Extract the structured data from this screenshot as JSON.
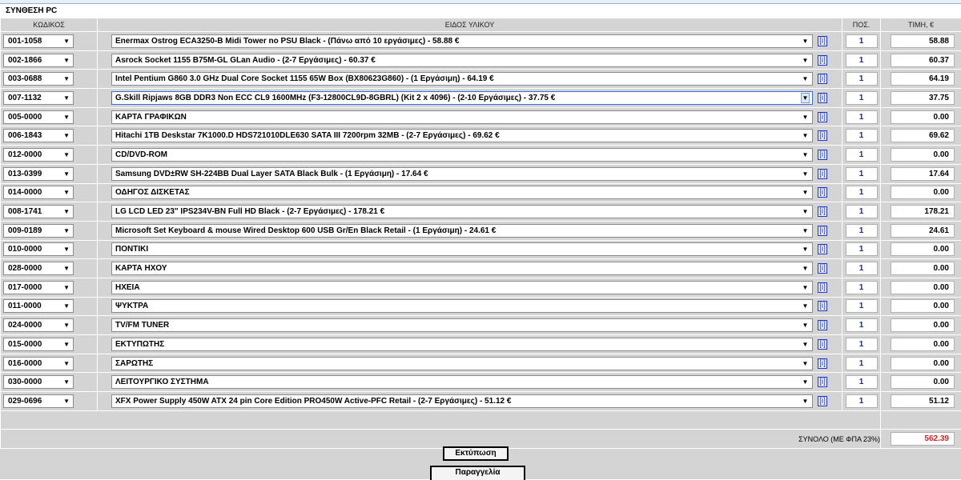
{
  "title": "ΣΥΝΘΕΣΗ PC",
  "headers": {
    "code": "ΚΩΔΙΚΟΣ",
    "item": "ΕΙΔΟΣ ΥΛΙΚΟΥ",
    "qty": "ΠΟΣ.",
    "price": "ΤΙΜΗ, €"
  },
  "info_label": "[i]",
  "rows": [
    {
      "code": "001-1058",
      "item": "Enermax Ostrog ECA3250-B Midi Tower no PSU Black - (Πάνω από 10 εργάσιμες) - 58.88 €",
      "qty": "1",
      "price": "58.88"
    },
    {
      "code": "002-1866",
      "item": "Asrock Socket 1155 B75M-GL GLan Audio - (2-7 Εργάσιμες) - 60.37 €",
      "qty": "1",
      "price": "60.37"
    },
    {
      "code": "003-0688",
      "item": "Intel Pentium G860 3.0 GHz Dual Core Socket 1155 65W Box (BX80623G860) - (1 Εργάσιμη) - 64.19 €",
      "qty": "1",
      "price": "64.19"
    },
    {
      "code": "007-1132",
      "item": "G.Skill Ripjaws 8GB DDR3 Non ECC CL9 1600MHz (F3-12800CL9D-8GBRL) (Kit 2 x 4096) - (2-10 Εργάσιμες) - 37.75 €",
      "qty": "1",
      "price": "37.75"
    },
    {
      "code": "005-0000",
      "item": "ΚΑΡΤΑ ΓΡΑΦΙΚΩΝ",
      "qty": "1",
      "price": "0.00"
    },
    {
      "code": "006-1843",
      "item": "Hitachi 1TB Deskstar 7K1000.D HDS721010DLE630 SATA III 7200rpm 32MB - (2-7 Εργάσιμες) - 69.62 €",
      "qty": "1",
      "price": "69.62"
    },
    {
      "code": "012-0000",
      "item": "CD/DVD-ROM",
      "qty": "1",
      "price": "0.00"
    },
    {
      "code": "013-0399",
      "item": "Samsung DVD±RW SH-224BB Dual Layer SATA Black Bulk - (1 Εργάσιμη) - 17.64 €",
      "qty": "1",
      "price": "17.64"
    },
    {
      "code": "014-0000",
      "item": "ΟΔΗΓΟΣ ΔΙΣΚΕΤΑΣ",
      "qty": "1",
      "price": "0.00"
    },
    {
      "code": "008-1741",
      "item": "LG LCD LED 23\" IPS234V-BN Full HD Black - (2-7 Εργάσιμες) - 178.21 €",
      "qty": "1",
      "price": "178.21"
    },
    {
      "code": "009-0189",
      "item": "Microsoft Set Keyboard & mouse Wired Desktop 600 USB Gr/En Black Retail - (1 Εργάσιμη) - 24.61 €",
      "qty": "1",
      "price": "24.61"
    },
    {
      "code": "010-0000",
      "item": "ΠΟΝΤΙΚΙ",
      "qty": "1",
      "price": "0.00"
    },
    {
      "code": "028-0000",
      "item": "ΚΑΡΤΑ ΗΧΟΥ",
      "qty": "1",
      "price": "0.00"
    },
    {
      "code": "017-0000",
      "item": "ΗΧΕΙΑ",
      "qty": "1",
      "price": "0.00"
    },
    {
      "code": "011-0000",
      "item": "ΨΥΚΤΡΑ",
      "qty": "1",
      "price": "0.00"
    },
    {
      "code": "024-0000",
      "item": "TV/FM TUNER",
      "qty": "1",
      "price": "0.00"
    },
    {
      "code": "015-0000",
      "item": "ΕΚΤΥΠΩΤΗΣ",
      "qty": "1",
      "price": "0.00"
    },
    {
      "code": "016-0000",
      "item": "ΣΑΡΩΤΗΣ",
      "qty": "1",
      "price": "0.00"
    },
    {
      "code": "030-0000",
      "item": "ΛΕΙΤΟΥΡΓΙΚΟ ΣΥΣΤΗΜΑ",
      "qty": "1",
      "price": "0.00"
    },
    {
      "code": "029-0696",
      "item": "XFX Power Supply 450W ATX 24 pin Core Edition PRO450W Active-PFC Retail - (2-7 Εργάσιμες) - 51.12 €",
      "qty": "1",
      "price": "51.12"
    }
  ],
  "focused_row": 3,
  "total": {
    "label": "ΣΥΝΟΛΟ (ΜΕ ΦΠΑ 23%)",
    "value": "562.39"
  },
  "buttons": {
    "print": "Εκτύπωση",
    "order": "Παραγγελία"
  },
  "colors": {
    "background": "#d4d4d4",
    "qty_text": "#0a2fb0",
    "total_value": "#d41e1e",
    "info_link": "#1a35c9"
  }
}
